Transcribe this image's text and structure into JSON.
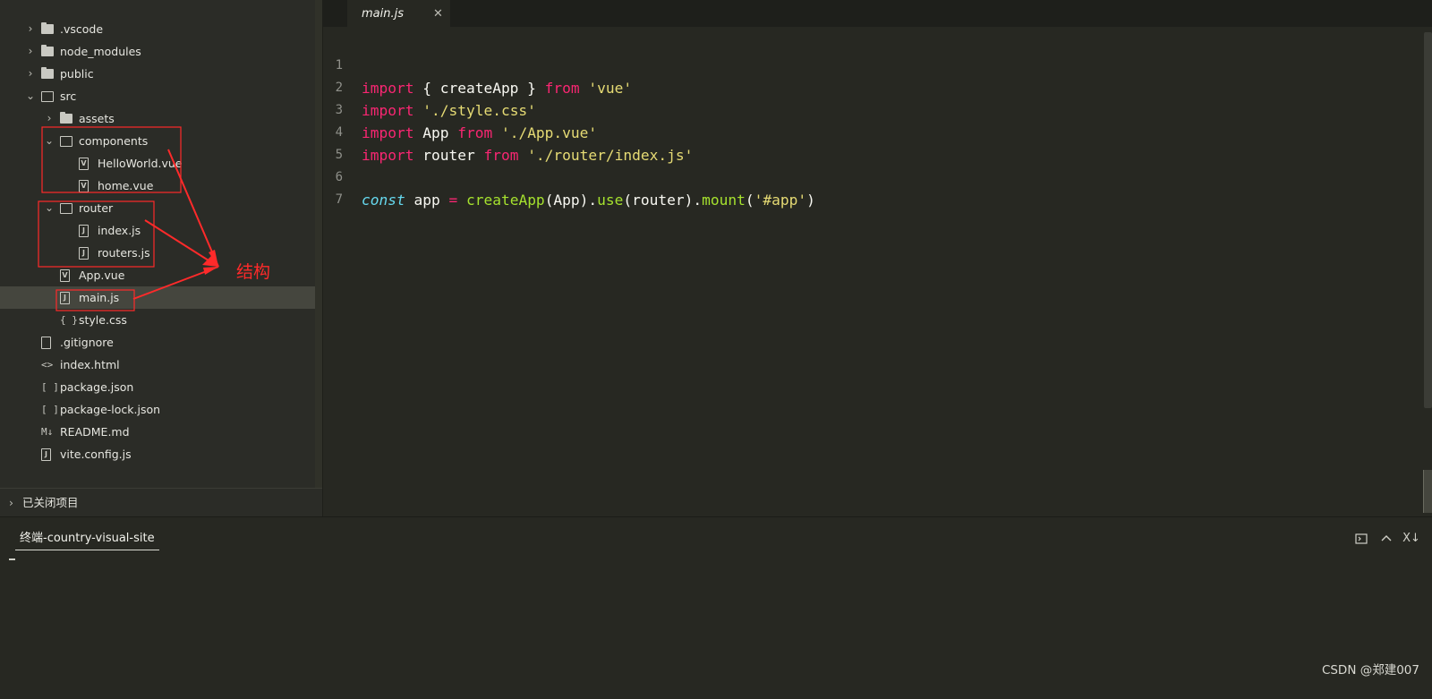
{
  "sidebar": {
    "tree": [
      {
        "label": ".vscode",
        "icon": "folder-icon",
        "chevron": "›",
        "selected": false
      },
      {
        "label": "node_modules",
        "icon": "folder-icon",
        "chevron": "›",
        "selected": false
      },
      {
        "label": "public",
        "icon": "folder-icon",
        "chevron": "›",
        "selected": false
      },
      {
        "label": "src",
        "icon": "folder-open-icon",
        "chevron": "⌄",
        "selected": false
      },
      {
        "label": "assets",
        "icon": "folder-icon",
        "chevron": "›",
        "selected": false
      },
      {
        "label": "components",
        "icon": "folder-open-icon",
        "chevron": "⌄",
        "selected": false
      },
      {
        "label": "HelloWorld.vue",
        "icon": "vue-file-icon",
        "selected": false
      },
      {
        "label": "home.vue",
        "icon": "vue-file-icon",
        "selected": false
      },
      {
        "label": "router",
        "icon": "folder-open-icon",
        "chevron": "⌄",
        "selected": false
      },
      {
        "label": "index.js",
        "icon": "js-file-icon",
        "selected": false
      },
      {
        "label": "routers.js",
        "icon": "js-file-icon",
        "selected": false
      },
      {
        "label": "App.vue",
        "icon": "vue-file-icon",
        "selected": false
      },
      {
        "label": "main.js",
        "icon": "js-file-icon",
        "selected": true
      },
      {
        "label": "style.css",
        "icon": "css-file-icon",
        "glyph": "{ }",
        "selected": false
      },
      {
        "label": ".gitignore",
        "icon": "file-icon",
        "selected": false
      },
      {
        "label": "index.html",
        "icon": "html-file-icon",
        "glyph": "<>",
        "selected": false
      },
      {
        "label": "package.json",
        "icon": "json-file-icon",
        "glyph": "[ ]",
        "selected": false
      },
      {
        "label": "package-lock.json",
        "icon": "json-file-icon",
        "glyph": "[ ]",
        "selected": false
      },
      {
        "label": "README.md",
        "icon": "markdown-file-icon",
        "glyph": "M↓",
        "selected": false
      },
      {
        "label": "vite.config.js",
        "icon": "js-file-icon",
        "selected": false
      }
    ],
    "closed_projects_label": "已关闭项目"
  },
  "editor": {
    "tab_label": "main.js",
    "tab_close": "✕",
    "line_numbers": [
      "1",
      "2",
      "3",
      "4",
      "5",
      "6",
      "7"
    ]
  },
  "terminal": {
    "tab_label": "终端-country-visual-site",
    "actions": [
      "terminal-new-icon",
      "chevron-up-icon",
      "close-all-icon"
    ],
    "close_all_label": "X↓"
  },
  "annotation": {
    "label": "结构",
    "color": "#ff2a2a"
  },
  "watermark": "CSDN @郑建007",
  "colors": {
    "background": "#272822",
    "sidebar": "#2b2c27",
    "keyword": "#f92672",
    "string": "#e6db74",
    "function": "#a6e22e",
    "storage": "#66d9ef"
  }
}
